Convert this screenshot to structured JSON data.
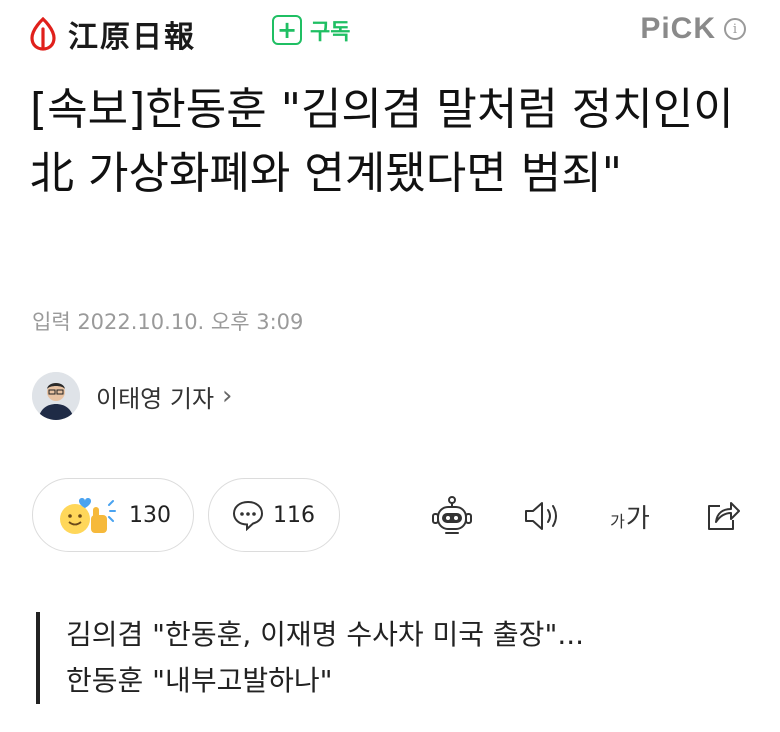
{
  "header": {
    "publisher_name": "江原日報",
    "subscribe_label": "구독",
    "subscribe_icon": "plus-icon",
    "pick_label": "PiCK",
    "info_icon": "info-icon",
    "accent_color": "#1fbf63",
    "logo_color": "#e0201b"
  },
  "article": {
    "headline": "[속보]한동훈 \"김의겸 말처럼 정치인이 北 가상화폐와 연계됐다면 범죄\"",
    "published": "입력 2022.10.10. 오후 3:09",
    "reporter": "이태영 기자"
  },
  "actions": {
    "reaction_count": "130",
    "comment_count": "116",
    "icons": [
      "emoji-reaction-icon",
      "comment-bubble-icon",
      "robot-summary-icon",
      "speaker-icon",
      "font-size-icon",
      "share-icon"
    ],
    "font_size_small": "가",
    "font_size_large": "가"
  },
  "summary": {
    "line1": "김의겸 \"한동훈, 이재명 수사차 미국 출장\"...",
    "line2": "한동훈 \"내부고발하나\""
  }
}
